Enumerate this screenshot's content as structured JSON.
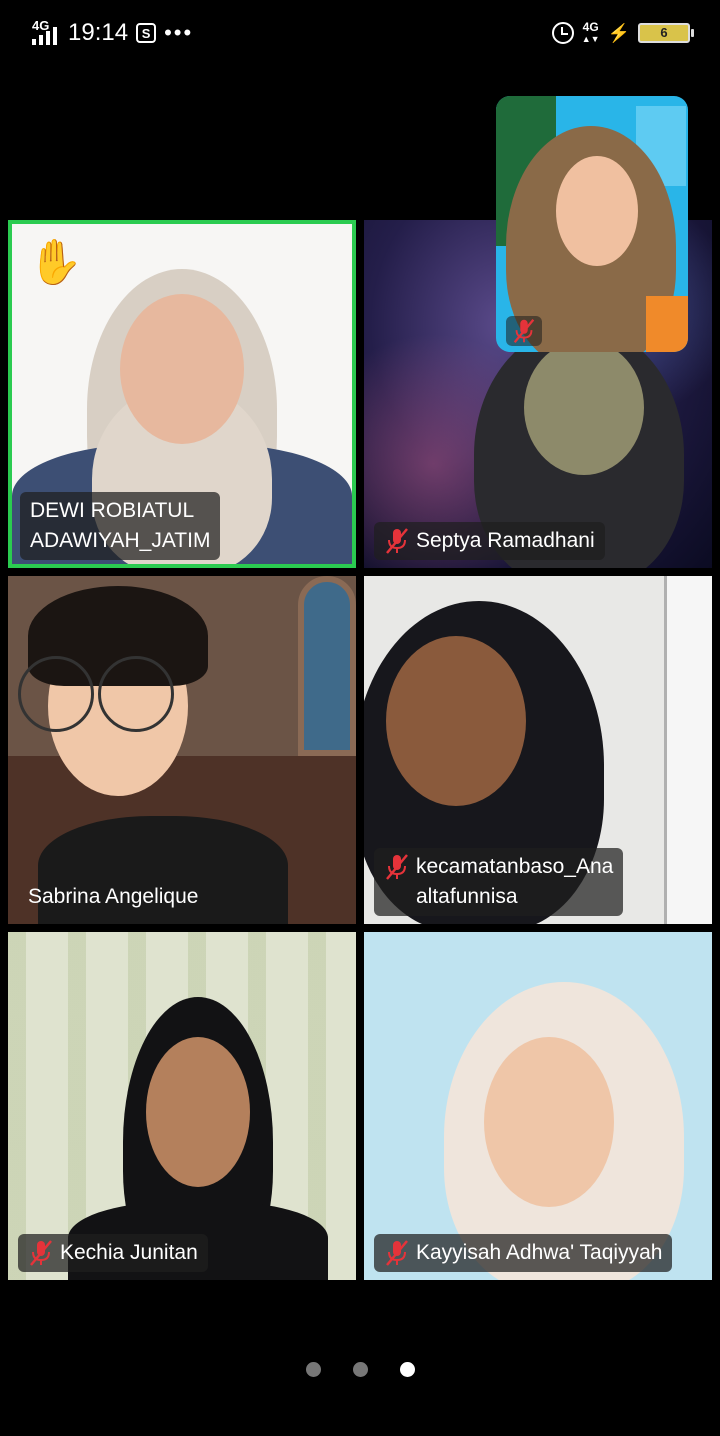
{
  "status_bar": {
    "network_left": "4G",
    "time": "19:14",
    "notif_badge": "S",
    "more": "•••",
    "network_right": "4G",
    "battery_level": "6"
  },
  "self_view": {
    "muted": true
  },
  "tiles": [
    {
      "name": "DEWI ROBIATUL\nADAWIYAH_JATIM",
      "muted": false,
      "active_speaker": true,
      "hand_raised": true,
      "hand_icon": "✋"
    },
    {
      "name": "Septya Ramadhani",
      "muted": true
    },
    {
      "name": "Sabrina Angelique",
      "muted": false
    },
    {
      "name": "kecamatanbaso_Ana\naltafunnisa",
      "muted": true
    },
    {
      "name": "Kechia Junitan",
      "muted": true
    },
    {
      "name": "Kayyisah Adhwa' Taqiyyah",
      "muted": true
    }
  ],
  "pagination": {
    "pages": 3,
    "current_page": 3
  },
  "colors": {
    "active_border": "#2bcb50",
    "mute_red": "#e5333a",
    "background": "#000000"
  }
}
